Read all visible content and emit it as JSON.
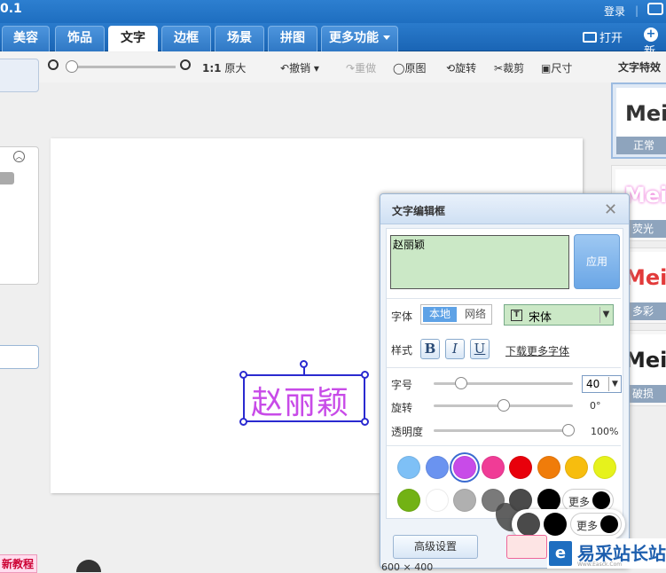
{
  "app": {
    "version": "0.1",
    "login": "登录",
    "open": "打开",
    "new": "新"
  },
  "tabs": [
    {
      "label": "美容"
    },
    {
      "label": "饰品"
    },
    {
      "label": "文字"
    },
    {
      "label": "边框"
    },
    {
      "label": "场景"
    },
    {
      "label": "拼图"
    },
    {
      "label": "更多功能"
    }
  ],
  "toolbar": {
    "ratio": "1:1",
    "original_size": "原大",
    "undo": "撤销",
    "redo": "重做",
    "original_image": "原图",
    "rotate": "旋转",
    "crop": "裁剪",
    "resize": "尺寸",
    "zoom": 0.0
  },
  "effects": {
    "title": "文字特效",
    "items": [
      {
        "preview": "Meitu",
        "label": "正常",
        "color": "#333333"
      },
      {
        "preview": "Meitu",
        "label": "荧光",
        "color": "#f08de0"
      },
      {
        "preview": "Meitu",
        "label": "多彩",
        "color": "#e23a3a"
      },
      {
        "preview": "Meitu",
        "label": "破损",
        "color": "#222222"
      }
    ]
  },
  "left_panel": {
    "tutorial": "新教程"
  },
  "canvas": {
    "text": "赵丽颖",
    "text_color": "#c84be8"
  },
  "dialog": {
    "title": "文字编辑框",
    "text_value": "赵丽颖",
    "apply": "应用",
    "font_label": "字体",
    "font_source_local": "本地",
    "font_source_web": "网络",
    "font_name": "宋体",
    "style_label": "样式",
    "bold": "B",
    "italic": "I",
    "underline": "U",
    "download_fonts": "下载更多字体",
    "size_label": "字号",
    "size_value": "40",
    "size_level": 0.2,
    "rotate_label": "旋转",
    "rotate_value": "0°",
    "rotate_level": 0.5,
    "opacity_label": "透明度",
    "opacity_value": "100%",
    "opacity_level": 1.0,
    "colors_row1": [
      "#7ec0f6",
      "#6a93f0",
      "#c84be8",
      "#f03c96",
      "#e8000b",
      "#f07c0a",
      "#f7bd0e",
      "#e6f21c"
    ],
    "colors_row2": [
      "#72b214",
      "#ffffff",
      "#b0b0b0",
      "#7a7a7a",
      "#4a4a4a",
      "#000000"
    ],
    "more": "更多",
    "advanced": "高级设置",
    "status_text": "600 × 400"
  },
  "watermark": {
    "logo_letter": "e",
    "text": "易采站长站",
    "sub": "Www.Easck.Com"
  }
}
